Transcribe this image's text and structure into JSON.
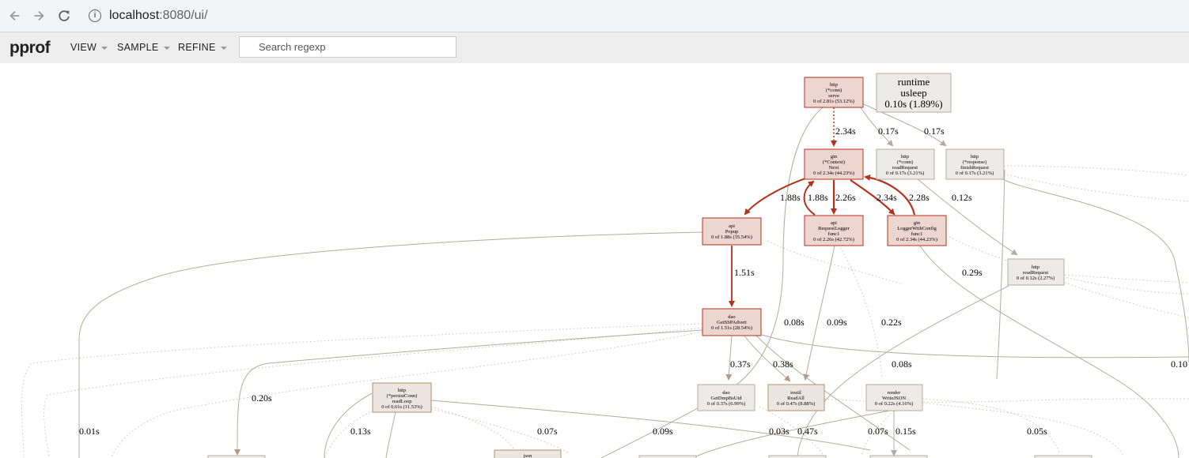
{
  "browser": {
    "url_host": "localhost",
    "url_rest": ":8080/ui/"
  },
  "app": {
    "brand": "pprof",
    "menus": [
      "VIEW",
      "SAMPLE",
      "REFINE"
    ],
    "search_placeholder": "Search regexp"
  },
  "colors": {
    "hot_fill": "#edd5d0",
    "hot_stroke": "#b2321b",
    "warm_fill": "#ede6e0",
    "warm_stroke": "#b28f6b",
    "cool_fill": "#edebe8",
    "cool_stroke": "#b2aca1",
    "hot_edge": "#b2321b",
    "cool_edge": "#b2aca1"
  },
  "graph": {
    "nodes": {
      "http_serve": [
        "http",
        "(*conn)",
        "serve",
        "0 of 2.81s (53.12%)"
      ],
      "runtime_usleep": [
        "runtime",
        "usleep",
        "0.10s (1.89%)"
      ],
      "gin_next": [
        "gin",
        "(*Context)",
        "Next",
        "0 of 2.34s (44.23%)"
      ],
      "http_readreq_conn": [
        "http",
        "(*conn)",
        "readRequest",
        "0 of 0.17s (3.21%)"
      ],
      "http_finishreq": [
        "http",
        "(*response)",
        "finishRequest",
        "0 of 0.17s (3.21%)"
      ],
      "api_popup": [
        "api",
        "Popup",
        "0 of 1.88s (35.54%)"
      ],
      "api_reqlogger": [
        "api",
        "RequestLogger",
        "func1",
        "0 of 2.26s (42.72%)"
      ],
      "gin_loggerconfig": [
        "gin",
        "LoggerWithConfig",
        "func1",
        "0 of 2.34s (44.23%)"
      ],
      "http_readrequest": [
        "http",
        "readRequest",
        "0 of 0.12s (2.27%)"
      ],
      "dao_getssp": [
        "dao",
        "GetSSPAdvert",
        "0 of 1.51s (28.54%)"
      ],
      "http_readloop": [
        "http",
        "(*persistConn)",
        "readLoop",
        "0 of 0.61s (11.53%)"
      ],
      "dao_getdmp": [
        "dao",
        "GetDmpBsUid",
        "0 of 0.37s (6.99%)"
      ],
      "ioutil_readall": [
        "ioutil",
        "ReadAll",
        "0 of 0.47s (8.88%)"
      ],
      "render_writejson": [
        "render",
        "WriteJSON",
        "0 of 0.22s (4.16%)"
      ],
      "json_partial": [
        "json"
      ]
    },
    "edge_labels": {
      "e_2_34a": "2.34s",
      "e_0_17a": "0.17s",
      "e_0_17b": "0.17s",
      "e_1_88a": "1.88s",
      "e_1_88b": "1.88s",
      "e_2_26": "2.26s",
      "e_2_34b": "2.34s",
      "e_2_28": "2.28s",
      "e_0_12": "0.12s",
      "e_1_51": "1.51s",
      "e_0_29": "0.29s",
      "e_0_08a": "0.08s",
      "e_0_09a": "0.09s",
      "e_0_22": "0.22s",
      "e_0_10": "0.10",
      "e_0_37": "0.37s",
      "e_0_38": "0.38s",
      "e_0_08b": "0.08s",
      "e_0_20": "0.20s",
      "e_0_01": "0.01s",
      "e_0_13": "0.13s",
      "e_0_07a": "0.07s",
      "e_0_09b": "0.09s",
      "e_0_03": "0.03s",
      "e_0_47": "0.47s",
      "e_0_07b": "0.07s",
      "e_0_15": "0.15s",
      "e_0_05": "0.05s"
    }
  }
}
